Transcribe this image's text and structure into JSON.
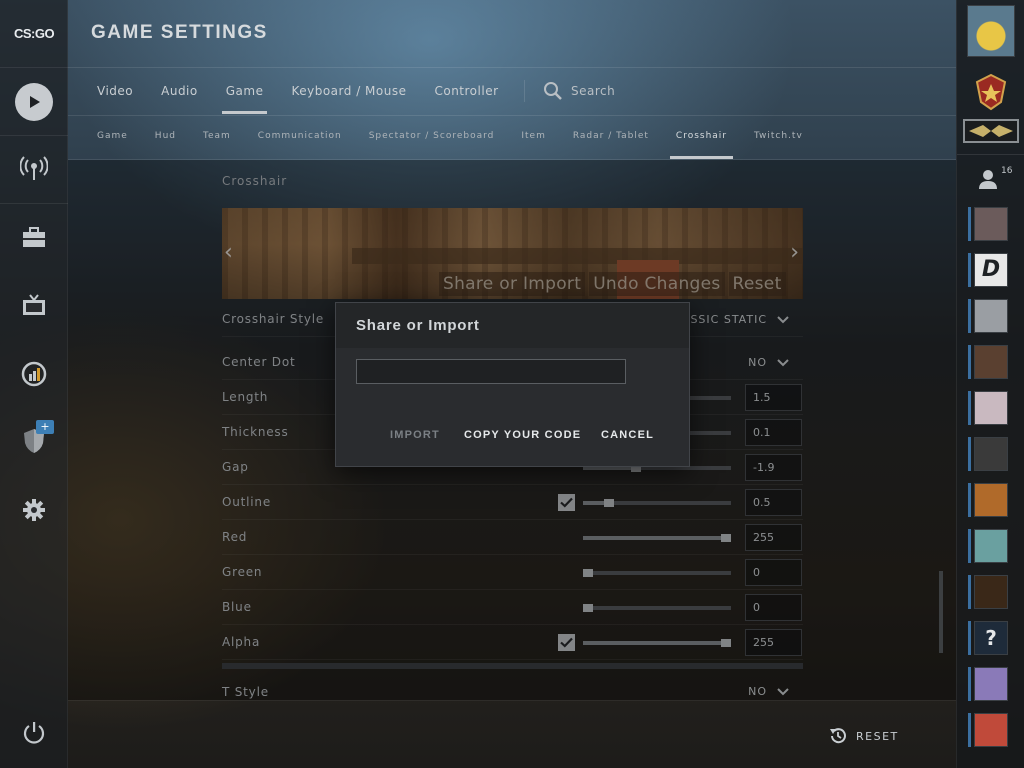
{
  "app": {
    "logo_text": "CS:GO",
    "window_title": "GAME SETTINGS"
  },
  "left_rail": {
    "items": [
      {
        "name": "play",
        "icon": "play-icon"
      },
      {
        "name": "watch",
        "icon": "antenna-icon"
      },
      {
        "name": "inventory",
        "icon": "briefcase-icon"
      },
      {
        "name": "tv",
        "icon": "tv-icon"
      },
      {
        "name": "stats",
        "icon": "stats-icon"
      },
      {
        "name": "operation",
        "icon": "shield-icon",
        "badge": "+"
      },
      {
        "name": "settings",
        "icon": "gear-icon"
      }
    ],
    "power_icon": "power-icon"
  },
  "tabs": [
    {
      "label": "Video",
      "active": false
    },
    {
      "label": "Audio",
      "active": false
    },
    {
      "label": "Game",
      "active": true
    },
    {
      "label": "Keyboard / Mouse",
      "active": false
    },
    {
      "label": "Controller",
      "active": false
    }
  ],
  "search": {
    "label": "Search"
  },
  "subtabs": [
    {
      "label": "Game"
    },
    {
      "label": "Hud"
    },
    {
      "label": "Team"
    },
    {
      "label": "Communication"
    },
    {
      "label": "Spectator / Scoreboard"
    },
    {
      "label": "Item"
    },
    {
      "label": "Radar / Tablet"
    },
    {
      "label": "Crosshair",
      "active": true
    },
    {
      "label": "Twitch.tv"
    }
  ],
  "section": {
    "title": "Crosshair"
  },
  "preview": {
    "left_arrow": "‹",
    "right_arrow": "›",
    "actions": [
      "Share or Import",
      "Undo Changes",
      "Reset"
    ]
  },
  "settings": [
    {
      "label": "Crosshair Style",
      "type": "dropdown",
      "value": "CLASSIC STATIC"
    },
    {
      "label": "Center Dot",
      "type": "dropdown",
      "value": "NO"
    },
    {
      "label": "Length",
      "type": "slider",
      "value": "1.5",
      "fraction": 0.15,
      "checkbox": false
    },
    {
      "label": "Thickness",
      "type": "slider",
      "value": "0.1",
      "fraction": 0.02,
      "checkbox": false
    },
    {
      "label": "Gap",
      "type": "slider",
      "value": "-1.9",
      "fraction": 0.35,
      "checkbox": false
    },
    {
      "label": "Outline",
      "type": "slider",
      "value": "0.5",
      "fraction": 0.15,
      "checkbox": true
    },
    {
      "label": "Red",
      "type": "slider",
      "value": "255",
      "fraction": 1.0,
      "checkbox": false
    },
    {
      "label": "Green",
      "type": "slider",
      "value": "0",
      "fraction": 0.0,
      "checkbox": false
    },
    {
      "label": "Blue",
      "type": "slider",
      "value": "0",
      "fraction": 0.0,
      "checkbox": false
    },
    {
      "label": "Alpha",
      "type": "slider",
      "value": "255",
      "fraction": 1.0,
      "checkbox": true
    }
  ],
  "t_style": {
    "label": "T Style",
    "value": "NO"
  },
  "footer": {
    "reset_label": "RESET"
  },
  "modal": {
    "title": "Share or Import",
    "input_value": "",
    "import_label": "IMPORT",
    "copy_label": "COPY YOUR CODE",
    "cancel_label": "CANCEL"
  },
  "friends": {
    "count": "16"
  },
  "colors": {
    "accent": "#3b6fa0",
    "modal_bg": "#2a2c2f",
    "disabled_text": "#7b8085"
  }
}
